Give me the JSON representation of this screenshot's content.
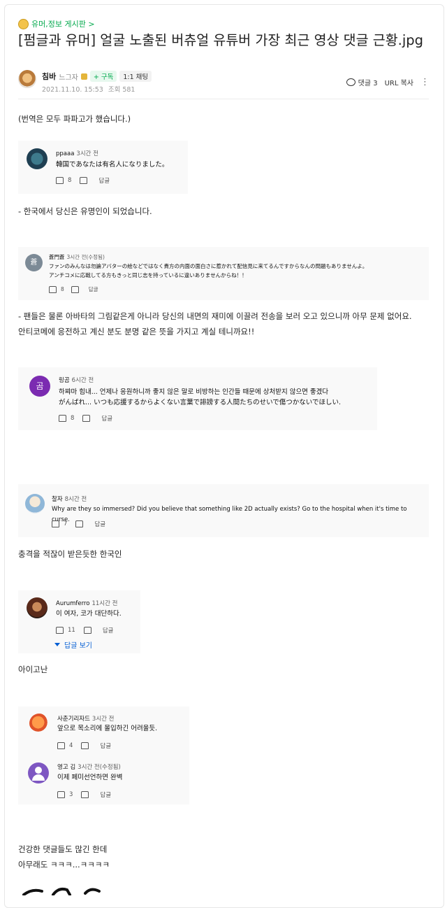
{
  "board": {
    "link": "유머,정보 게시판 >"
  },
  "post": {
    "title": "[펌글과 유머] 얼굴 노출된 버츄얼 유튜버 가장 최근 영상 댓글 근황.jpg",
    "author": "침바",
    "grade": "느그자",
    "subscribe": "+ 구독",
    "chat": "1:1 채팅",
    "date": "2021.11.10. 15:53",
    "views": "조회 581",
    "comment_label": "댓글 3",
    "url_copy": "URL 복사",
    "more": "⋮"
  },
  "paragraphs": {
    "p1": "(번역은 모두 파파고가 했습니다.)",
    "p2": "- 한국에서 당신은 유명인이 되었습니다.",
    "p3a": "- 팬들은 물론 아바타의 그림같은게 아니라 당신의 내면의 재미에 이끌려 전송을 보러 오고 있으니까 아무 문제 없어요.",
    "p3b": "안티코메에 응전하고 계신 분도 분명 같은 뜻을 가지고 계실 테니까요!!",
    "p4": "충격을 적잖이 받은듯한 한국인",
    "p5": "아이고난",
    "p6a": "건강한 댓글들도 많긴 한데",
    "p6b": "아무래도 ㅋㅋㅋ...ㅋㅋㅋㅋ"
  },
  "comments": [
    {
      "user": "ppaaa",
      "time": "3시간 전",
      "text": "韓国であなたは有名人になりました。",
      "likes": "8",
      "reply": "답글"
    },
    {
      "user": "蒼門蒼",
      "time": "3시간 전(수정됨)",
      "text1": "ファンのみんなは勿論アバターの絵などではなく貴方の内面の面白さに惹かれて配信見に来てるんですからなんの問題もありませんよ。",
      "text2": "アンチコメに応戦してる方もきっと同じ志を持っているに違いありませんからね！！",
      "likes": "8",
      "reply": "답글",
      "initial": "蒼"
    },
    {
      "user": "링곰",
      "time": "6시간 전",
      "text1": "하쨔마 힘내... 언제나 응원하니까 좋지 않은 말로 비방하는 인간들 때문에 상처받지 않으면 좋겠다",
      "text2": "がんばれ... いつも応援するからよくない言葉で誹謗する人間たちのせいで傷つかないでほしい.",
      "likes": "8",
      "reply": "답글",
      "initial": "곰"
    },
    {
      "user": "찰자",
      "time": "8시간 전",
      "text": "Why are they so immersed? Did you believe that something like 2D actually exists? Go to the hospital when it's time to curse.",
      "likes": "7",
      "reply": "답글"
    },
    {
      "user": "Aurumferro",
      "time": "11시간 전",
      "text": "이 여자, 코가 대단하다.",
      "likes": "11",
      "reply": "답글",
      "view_replies": "답글 보기"
    },
    {
      "user": "사춘기리자드",
      "time": "3시간 전",
      "text": "앞으로 목소리에 몰입하긴 어려울듯.",
      "likes": "4",
      "reply": "답글"
    },
    {
      "user": "영고 김",
      "time": "3시간 전(수정됨)",
      "text": "이제 페미선언하면 완벽",
      "likes": "3",
      "reply": "답글"
    }
  ]
}
